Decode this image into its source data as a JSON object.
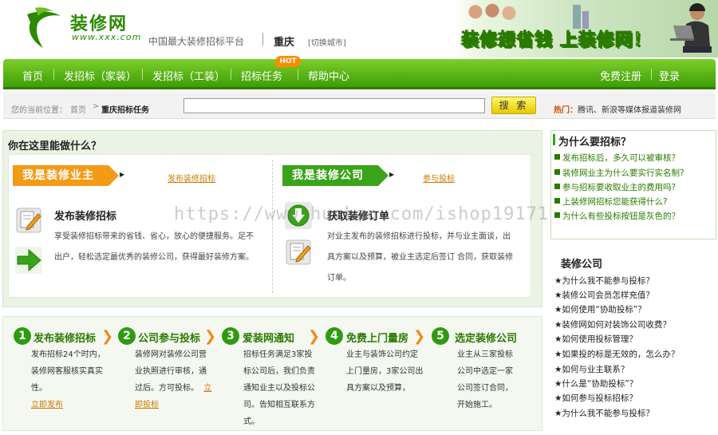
{
  "header": {
    "logo_name": "装修网",
    "logo_url": "www.xxx.com",
    "slogan": "中国最大装修招标平台",
    "city": "重庆",
    "switch_city": "[切换城市]",
    "banner_text": "装修想省钱 上装修网！"
  },
  "nav": {
    "items": [
      "首页",
      "发招标（家装）",
      "发招标（工装）",
      "招标任务",
      "帮助中心"
    ],
    "hot_badge": "HOT",
    "register": "免费注册",
    "login": "登录"
  },
  "subbar": {
    "location_label": "您的当前位置：",
    "home": "首页",
    "arrow": ">",
    "current": "重庆招标任务",
    "search_value": "",
    "search_button": "搜 索",
    "hot_label": "热门：",
    "hot_text": "腾讯、新浪等媒体报道装修网"
  },
  "main": {
    "title": "你在这里能做什么？",
    "owner": {
      "tag": "我是装修业主",
      "link": "发布装修招标",
      "item_title": "发布装修招标",
      "desc_lines": [
        "享受装修招标带来的省钱、省心，放心的便捷服务。足不",
        "出户，轻松选定最优秀的装修公司，获得最好装修方案。"
      ]
    },
    "company": {
      "tag": "我是装修公司",
      "link": "参与投标",
      "item_title": "获取装修订单",
      "desc_lines": [
        "对业主发布的装修招标进行投标，并与业主面谈，出",
        "具方案以及预算，被业主选定后签订 合同，获取装修",
        "订单。"
      ]
    }
  },
  "steps": [
    {
      "num": "1",
      "title": "发布装修招标",
      "lines": [
        "发布招标24个时内，",
        "装修网客服核实真实",
        "性。"
      ],
      "link": "立即发布"
    },
    {
      "num": "2",
      "title": "公司参与投标",
      "lines": [
        "装修网对装修公司营",
        "业执照进行审核，通",
        "过后。方可投标。"
      ],
      "link_inline": "立",
      "link_line": "即投标"
    },
    {
      "num": "3",
      "title": "爱装网通知",
      "lines": [
        "招标任务满足3家投",
        "标公司后，我们负责",
        "通知业主以及投标公",
        "司。告知相互联系方",
        "式。"
      ]
    },
    {
      "num": "4",
      "title": "免费上门量房",
      "lines": [
        "业主与装饰公司约定",
        "上门量房，3家公司出",
        "具方案以及预算，"
      ]
    },
    {
      "num": "5",
      "title": "选定装修公司",
      "lines": [
        "业主从三家投标",
        "公司中选定一家",
        "公司签订合同，",
        "开始施工。"
      ]
    }
  ],
  "sidebar": {
    "why_title": "为什么要招标？",
    "why_items": [
      "发布招标后，多久可以被审核？",
      "装修网业主为什么要实行实名制?",
      "参与招标要收取业主的费用吗?",
      "上装修网招标您能获得什么?",
      "为什么有些投标按钮是灰色的？"
    ],
    "company_title": "装修公司",
    "company_items": [
      "★为什么我不能参与投标？",
      "★装修公司会员怎样充值？",
      "★如何使用“协助投标”？",
      "★装修网如何对装饰公司收费？",
      "★如何使用投标管理？",
      "★如果投的标是无效的，怎么办？",
      "★如何与业主联系？",
      "★什么是“协助投标”？",
      "★如何参与投标招标？",
      "★为什么我不能参与投标？"
    ]
  },
  "watermark": "https://www.huzhan.com/ishop19171"
}
